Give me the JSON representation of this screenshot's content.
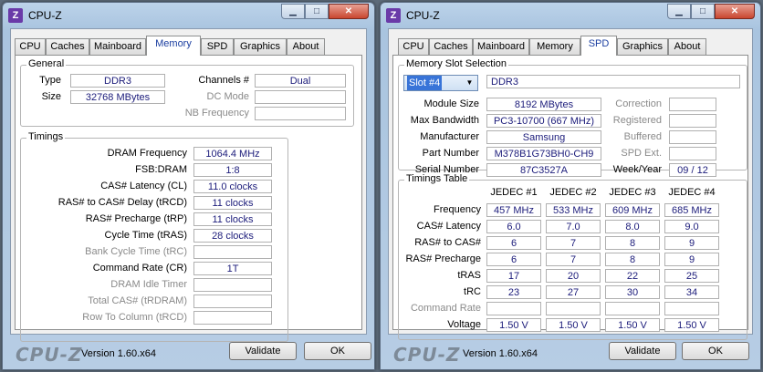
{
  "left": {
    "title": "CPU-Z",
    "tabs": [
      "CPU",
      "Caches",
      "Mainboard",
      "Memory",
      "SPD",
      "Graphics",
      "About"
    ],
    "active_tab": "Memory",
    "general": {
      "label": "General",
      "type_label": "Type",
      "type_value": "DDR3",
      "size_label": "Size",
      "size_value": "32768 MBytes",
      "channels_label": "Channels #",
      "channels_value": "Dual",
      "dcmode_label": "DC Mode",
      "dcmode_value": "",
      "nbfreq_label": "NB Frequency",
      "nbfreq_value": ""
    },
    "timings": {
      "label": "Timings",
      "rows": [
        {
          "label": "DRAM Frequency",
          "value": "1064.4 MHz",
          "enabled": true
        },
        {
          "label": "FSB:DRAM",
          "value": "1:8",
          "enabled": true
        },
        {
          "label": "CAS# Latency (CL)",
          "value": "11.0 clocks",
          "enabled": true
        },
        {
          "label": "RAS# to CAS# Delay (tRCD)",
          "value": "11 clocks",
          "enabled": true
        },
        {
          "label": "RAS# Precharge (tRP)",
          "value": "11 clocks",
          "enabled": true
        },
        {
          "label": "Cycle Time (tRAS)",
          "value": "28 clocks",
          "enabled": true
        },
        {
          "label": "Bank Cycle Time (tRC)",
          "value": "",
          "enabled": false
        },
        {
          "label": "Command Rate (CR)",
          "value": "1T",
          "enabled": true
        },
        {
          "label": "DRAM Idle Timer",
          "value": "",
          "enabled": false
        },
        {
          "label": "Total CAS# (tRDRAM)",
          "value": "",
          "enabled": false
        },
        {
          "label": "Row To Column (tRCD)",
          "value": "",
          "enabled": false
        }
      ]
    },
    "footer": {
      "brand": "CPU-Z",
      "version": "Version 1.60.x64",
      "validate": "Validate",
      "ok": "OK"
    }
  },
  "right": {
    "title": "CPU-Z",
    "tabs": [
      "CPU",
      "Caches",
      "Mainboard",
      "Memory",
      "SPD",
      "Graphics",
      "About"
    ],
    "active_tab": "SPD",
    "slot": {
      "label": "Memory Slot Selection",
      "selected": "Slot #4",
      "type_value": "DDR3",
      "fields": [
        {
          "label": "Module Size",
          "value": "8192 MBytes"
        },
        {
          "label": "Max Bandwidth",
          "value": "PC3-10700 (667 MHz)"
        },
        {
          "label": "Manufacturer",
          "value": "Samsung"
        },
        {
          "label": "Part Number",
          "value": "M378B1G73BH0-CH9"
        },
        {
          "label": "Serial Number",
          "value": "87C3527A"
        }
      ],
      "side_fields": [
        {
          "label": "Correction",
          "value": "",
          "enabled": false
        },
        {
          "label": "Registered",
          "value": "",
          "enabled": false
        },
        {
          "label": "Buffered",
          "value": "",
          "enabled": false
        },
        {
          "label": "SPD Ext.",
          "value": "",
          "enabled": false
        },
        {
          "label": "Week/Year",
          "value": "09 / 12",
          "enabled": true
        }
      ]
    },
    "timings_table": {
      "label": "Timings Table",
      "columns": [
        "JEDEC #1",
        "JEDEC #2",
        "JEDEC #3",
        "JEDEC #4"
      ],
      "rows": [
        {
          "label": "Frequency",
          "enabled": true,
          "values": [
            "457 MHz",
            "533 MHz",
            "609 MHz",
            "685 MHz"
          ]
        },
        {
          "label": "CAS# Latency",
          "enabled": true,
          "values": [
            "6.0",
            "7.0",
            "8.0",
            "9.0"
          ]
        },
        {
          "label": "RAS# to CAS#",
          "enabled": true,
          "values": [
            "6",
            "7",
            "8",
            "9"
          ]
        },
        {
          "label": "RAS# Precharge",
          "enabled": true,
          "values": [
            "6",
            "7",
            "8",
            "9"
          ]
        },
        {
          "label": "tRAS",
          "enabled": true,
          "values": [
            "17",
            "20",
            "22",
            "25"
          ]
        },
        {
          "label": "tRC",
          "enabled": true,
          "values": [
            "23",
            "27",
            "30",
            "34"
          ]
        },
        {
          "label": "Command Rate",
          "enabled": false,
          "values": [
            "",
            "",
            "",
            ""
          ]
        },
        {
          "label": "Voltage",
          "enabled": true,
          "values": [
            "1.50 V",
            "1.50 V",
            "1.50 V",
            "1.50 V"
          ]
        }
      ]
    },
    "footer": {
      "brand": "CPU-Z",
      "version": "Version 1.60.x64",
      "validate": "Validate",
      "ok": "OK"
    }
  }
}
